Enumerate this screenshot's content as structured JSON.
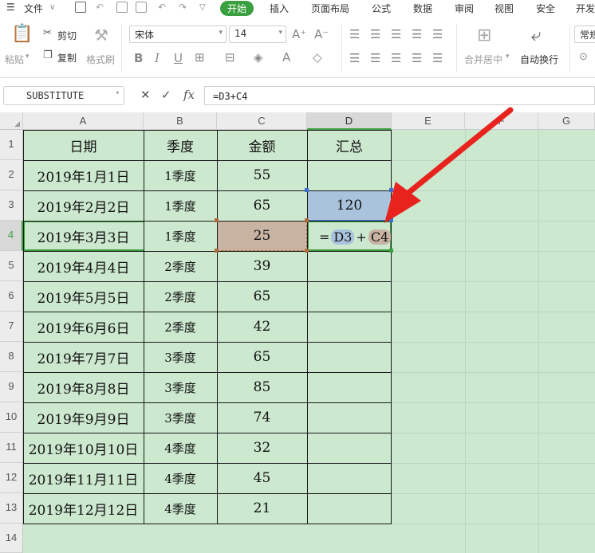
{
  "menubar": {
    "file": "文件",
    "items": [
      "开始",
      "插入",
      "页面布局",
      "公式",
      "数据",
      "审阅",
      "视图",
      "安全",
      "开发"
    ]
  },
  "ribbon": {
    "paste": "粘贴",
    "cut": "剪切",
    "copy": "复制",
    "format_painter": "格式刷",
    "font_name": "宋体",
    "font_size": "14",
    "merge_center": "合并居中",
    "wrap_text": "自动换行",
    "number_format": "常规"
  },
  "formula_bar": {
    "name_box": "SUBSTITUTE",
    "fx": "fx",
    "formula": "=D3+C4"
  },
  "columns": [
    "A",
    "B",
    "C",
    "D",
    "E",
    "F",
    "G"
  ],
  "rows": [
    "1",
    "2",
    "3",
    "4",
    "5",
    "6",
    "7",
    "8",
    "9",
    "10",
    "11",
    "12",
    "13",
    "14"
  ],
  "table": {
    "headers": [
      "日期",
      "季度",
      "金额",
      "汇总"
    ],
    "rows": [
      [
        "2019年1月1日",
        "1季度",
        "55",
        ""
      ],
      [
        "2019年2月2日",
        "1季度",
        "65",
        "120"
      ],
      [
        "2019年3月3日",
        "1季度",
        "25",
        ""
      ],
      [
        "2019年4月4日",
        "2季度",
        "39",
        ""
      ],
      [
        "2019年5月5日",
        "2季度",
        "65",
        ""
      ],
      [
        "2019年6月6日",
        "2季度",
        "42",
        ""
      ],
      [
        "2019年7月7日",
        "3季度",
        "65",
        ""
      ],
      [
        "2019年8月8日",
        "3季度",
        "85",
        ""
      ],
      [
        "2019年9月9日",
        "3季度",
        "74",
        ""
      ],
      [
        "2019年10月10日",
        "4季度",
        "32",
        ""
      ],
      [
        "2019年11月11日",
        "4季度",
        "45",
        ""
      ],
      [
        "2019年12月12日",
        "4季度",
        "21",
        ""
      ]
    ]
  },
  "editing_cell": {
    "eq": "=",
    "ref1": "D3",
    "plus": "+",
    "ref2": "C4"
  },
  "colors": {
    "accent": "#3a9f3e",
    "sheet_bg": "#cce8cf",
    "ref1_highlight": "#a9c3dc",
    "ref2_highlight": "#c9b3a3",
    "arrow": "#e8231e"
  }
}
